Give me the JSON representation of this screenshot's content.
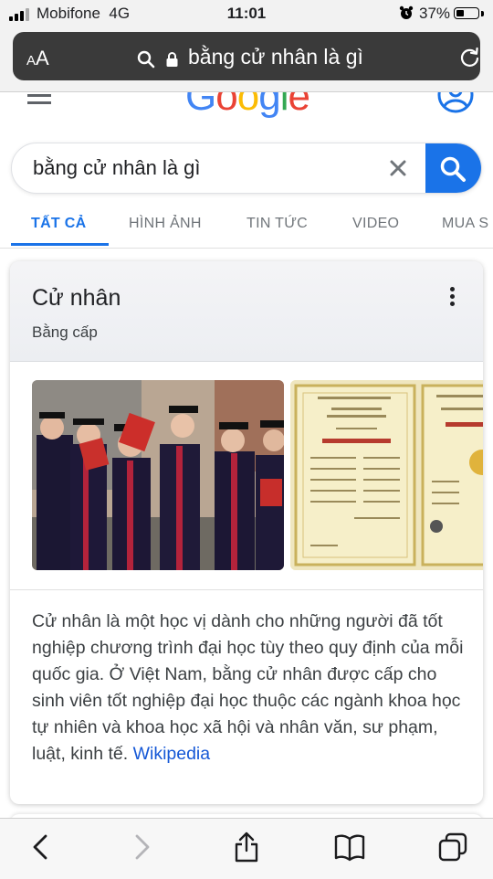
{
  "status_bar": {
    "carrier": "Mobifone",
    "network": "4G",
    "time": "11:01",
    "battery_percent": "37%",
    "battery_level": 0.37,
    "alarm_icon": "alarm-clock-icon"
  },
  "browser": {
    "text_size_label": "AA",
    "address_text": "bằng cử nhân là gì",
    "icons": [
      "search-icon",
      "lock-icon",
      "reload-icon"
    ]
  },
  "google": {
    "logo_text": "Google",
    "logo_colors": [
      "#4285f4",
      "#ea4335",
      "#fbbc05",
      "#4285f4",
      "#34a853",
      "#ea4335"
    ],
    "search_query": "bằng cử nhân là gì",
    "tabs": [
      {
        "label": "TẤT CẢ",
        "active": true
      },
      {
        "label": "HÌNH ẢNH",
        "active": false
      },
      {
        "label": "TIN TỨC",
        "active": false
      },
      {
        "label": "VIDEO",
        "active": false
      },
      {
        "label": "MUA S",
        "active": false
      }
    ],
    "accent_color": "#1a73e8"
  },
  "knowledge_panel": {
    "title": "Cử nhân",
    "subtitle": "Bằng cấp",
    "images": [
      "graduates-photo",
      "diploma-photo"
    ],
    "description": "Cử nhân là một học vị dành cho những người đã tốt nghiệp chương trình đại học tùy theo quy định của mỗi quốc gia. Ở Việt Nam, bằng cử nhân được cấp cho sinh viên tốt nghiệp đại học thuộc các ngành khoa học tự nhiên và khoa học xã hội và nhân văn, sư phạm, luật, kinh tế.",
    "source_link": "Wikipedia"
  },
  "toolbar": {
    "icons": [
      "back-icon",
      "forward-icon",
      "share-icon",
      "bookmarks-icon",
      "tabs-icon"
    ]
  }
}
